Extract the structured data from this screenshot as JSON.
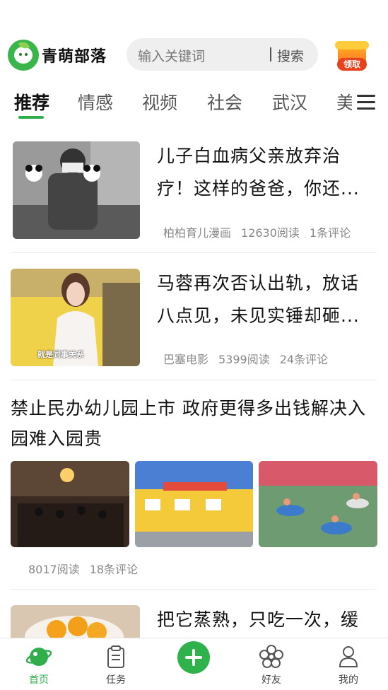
{
  "header": {
    "brand": "青萌部落",
    "search_placeholder": "输入关键词",
    "search_button": "搜索",
    "reward_label": "领取"
  },
  "tabs": [
    "推荐",
    "情感",
    "视频",
    "社会",
    "武汉",
    "美"
  ],
  "articles": [
    {
      "title": "儿子白血病父亲放弃治疗！这样的爸爸，你还...",
      "source": "柏柏育儿漫画",
      "reads": "12630阅读",
      "comments": "1条评论"
    },
    {
      "title": "马蓉再次否认出轨，放话八点见，未见实锤却砸...",
      "source": "巴塞电影",
      "reads": "5399阅读",
      "comments": "24条评论",
      "image_caption": "就是同事关系"
    },
    {
      "title": "禁止民办幼儿园上市 政府更得多出钱解决入园难入园贵",
      "reads": "8017阅读",
      "comments": "18条评论"
    },
    {
      "title": "把它蒸熟，只吃一次，缓"
    }
  ],
  "bottom_nav": {
    "home": "首页",
    "tasks": "任务",
    "friends": "好友",
    "mine": "我的"
  },
  "colors": {
    "accent": "#2fae4b",
    "reward": "#ff8a24"
  }
}
